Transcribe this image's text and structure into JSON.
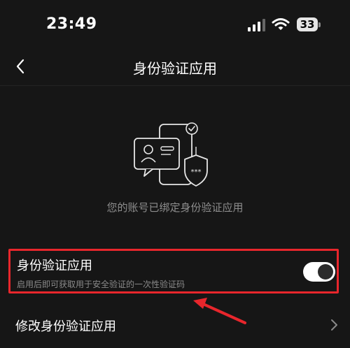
{
  "status_bar": {
    "time": "23:49",
    "battery_level": "33"
  },
  "nav": {
    "title": "身份验证应用",
    "back_icon": "chevron-left-icon"
  },
  "illustration": {
    "icon": "authenticator-phone-shield-icon",
    "shield_text": "***"
  },
  "status_text": "您的账号已绑定身份验证应用",
  "authenticator_setting": {
    "title": "身份验证应用",
    "description": "启用后即可获取用于安全验证的一次性验证码",
    "enabled": true,
    "highlight_color": "#e8262c"
  },
  "modify_row": {
    "label": "修改身份验证应用",
    "chevron_icon": "chevron-right-icon"
  },
  "colors": {
    "background": "#161616",
    "annotation": "#e8262c",
    "toggle_on": "#ffffff"
  }
}
